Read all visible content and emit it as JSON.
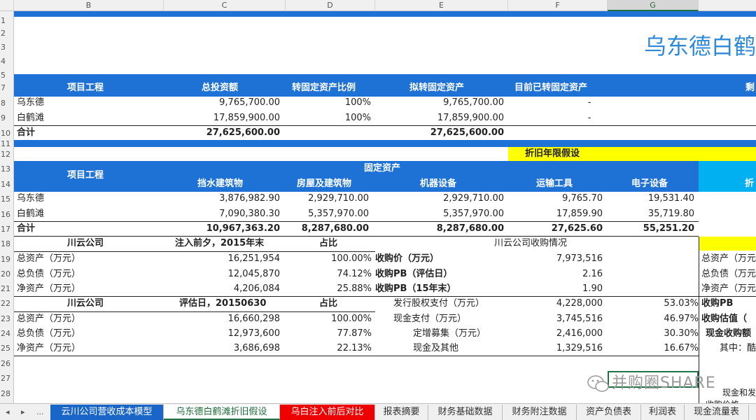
{
  "columns": [
    "B",
    "C",
    "D",
    "E",
    "F",
    "G"
  ],
  "rows": [
    "1",
    "2",
    "3",
    "4",
    "5",
    "7",
    "8",
    "9",
    "10",
    "11",
    "12",
    "13",
    "14",
    "15",
    "16",
    "17",
    "18",
    "19",
    "20",
    "21",
    "22",
    "23",
    "24",
    "25",
    "26",
    "27",
    "28"
  ],
  "title": "乌东德白鹤",
  "t1": {
    "headers": [
      "项目工程",
      "总投资额",
      "转固定资产比例",
      "拟转固定资产",
      "目前已转固定资产",
      "剩"
    ],
    "rows": [
      [
        "乌东德",
        "9,765,700.00",
        "100%",
        "9,765,700.00",
        "-"
      ],
      [
        "白鹤滩",
        "17,859,900.00",
        "100%",
        "17,859,900.00",
        "-"
      ]
    ],
    "total": [
      "合计",
      "27,625,600.00",
      "27,625,600.00"
    ]
  },
  "depr_label": "折旧年限假设",
  "t2": {
    "h_project": "项目工程",
    "h_group": "固定资产",
    "h_cols": [
      "挡水建筑物",
      "房屋及建筑物",
      "机器设备",
      "运输工具",
      "电子设备"
    ],
    "h_extra": "折",
    "rows": [
      [
        "乌东德",
        "3,876,982.90",
        "2,929,710.00",
        "2,929,710.00",
        "9,765.70",
        "19,531.40"
      ],
      [
        "白鹤滩",
        "7,090,380.30",
        "5,357,970.00",
        "5,357,970.00",
        "17,859.90",
        "35,719.80"
      ]
    ],
    "total": [
      "合计",
      "10,967,363.20",
      "8,287,680.00",
      "8,287,680.00",
      "27,625.60",
      "55,251.20"
    ]
  },
  "cy1": {
    "h": [
      "川云公司",
      "注入前夕，2015年末",
      "占比"
    ],
    "rows": [
      [
        "总资产（万元）",
        "16,251,954",
        "100.00%"
      ],
      [
        "总负债（万元）",
        "12,045,870",
        "74.12%"
      ],
      [
        "净资产（万元）",
        "4,206,084",
        "25.88%"
      ]
    ]
  },
  "cy2": {
    "h": [
      "川云公司",
      "评估日，20150630",
      "占比"
    ],
    "rows": [
      [
        "总资产（万元）",
        "16,660,298",
        "100.00%"
      ],
      [
        "总负债（万元）",
        "12,973,600",
        "77.87%"
      ],
      [
        "净资产（万元）",
        "3,686,698",
        "22.13%"
      ]
    ]
  },
  "acq": {
    "title": "川云公司收购情况",
    "rows": [
      [
        "收购价（万元）",
        "7,973,516"
      ],
      [
        "收购PB（评估日）",
        "2.16"
      ],
      [
        "收购PB（15年末）",
        "1.90"
      ]
    ],
    "pay": [
      [
        "发行股权支付（万元）",
        "4,228,000",
        "53.03%"
      ],
      [
        "现金支付（万元）",
        "3,745,516",
        "46.97%"
      ],
      [
        "定增募集（万元）",
        "2,416,000",
        "30.30%"
      ],
      [
        "现金及其他",
        "1,329,516",
        "16.67%"
      ]
    ]
  },
  "right": [
    "总资产（万元",
    "总负债（万元",
    "净资产（万元",
    "收购PB",
    "收购估值（",
    "现金收购额",
    "其中：酷"
  ],
  "right2": [
    "现金和发",
    "收购价格"
  ],
  "watermark": "并购圈SHARE",
  "tabs": [
    "云川公司营收成本模型",
    "乌东德白鹤滩折旧假设",
    "乌白注入前后对比",
    "报表摘要",
    "财务基础数据",
    "财务附注数据",
    "资产负债表",
    "利润表",
    "现金流量表"
  ],
  "nav": [
    "◂",
    "▸",
    "..."
  ]
}
